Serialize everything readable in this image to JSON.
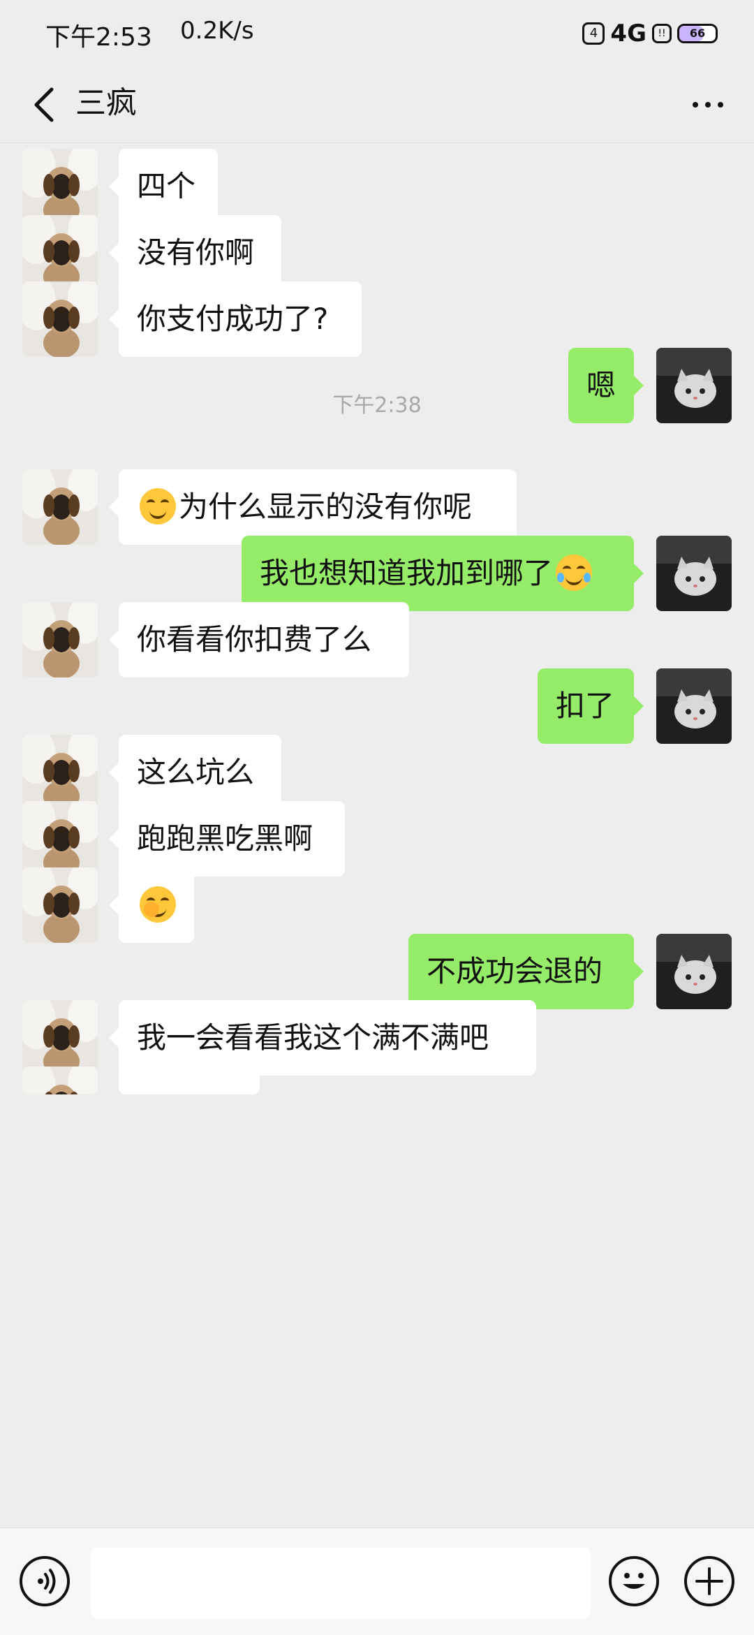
{
  "status_bar": {
    "time": "下午2:53",
    "speed": "0.2K/s",
    "sim_badge": "4",
    "network": "4G",
    "hd_badge": "!!",
    "battery": "66",
    "battery_level": 0.66
  },
  "header": {
    "title": "三疯"
  },
  "messages": [
    {
      "side": "left",
      "text": "四个"
    },
    {
      "side": "left",
      "text": "没有你啊"
    },
    {
      "side": "left",
      "text": "你支付成功了?"
    },
    {
      "side": "right",
      "text": "嗯"
    },
    {
      "timestamp": "下午2:38"
    },
    {
      "side": "left",
      "text": "为什么显示的没有你呢",
      "emoji": "smirk-emoji"
    },
    {
      "side": "right",
      "text": "我也想知道我加到哪了",
      "emoji": "tears-of-joy-emoji"
    },
    {
      "side": "left",
      "text": "你看看你扣费了么"
    },
    {
      "side": "right",
      "text": "扣了"
    },
    {
      "side": "left",
      "text": "这么坑么"
    },
    {
      "side": "left",
      "text": "跑跑黑吃黑啊"
    },
    {
      "side": "left",
      "text": "",
      "emoji": "facepalm-emoji"
    },
    {
      "side": "right",
      "text": "不成功会退的"
    },
    {
      "side": "left",
      "text": "我一会看看我这个满不满吧"
    }
  ],
  "colors": {
    "background": "#ededed",
    "bubble_self": "#95ec69",
    "bubble_other": "#ffffff"
  }
}
